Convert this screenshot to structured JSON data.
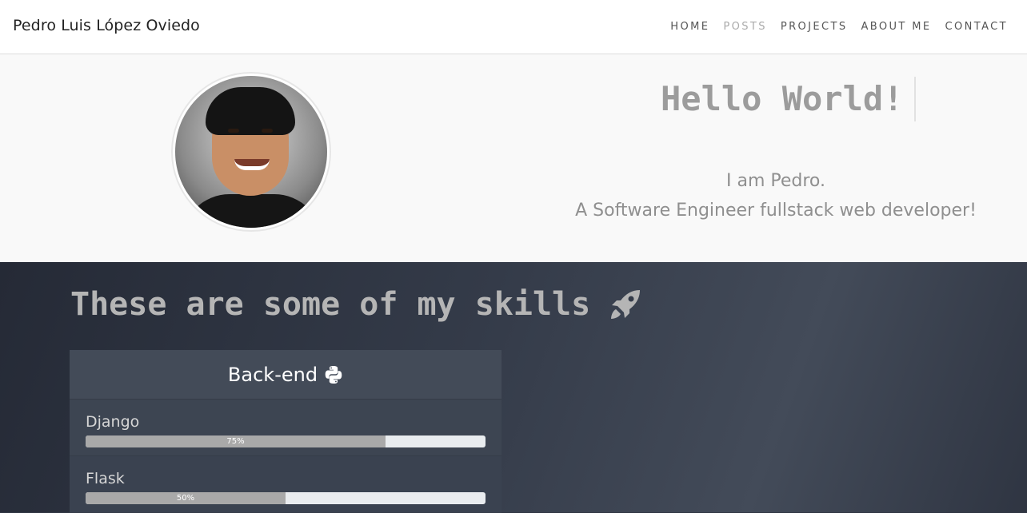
{
  "brand": "Pedro Luis López Oviedo",
  "nav": {
    "home": "HOME",
    "posts": "POSTS",
    "projects": "PROJECTS",
    "about": "ABOUT ME",
    "contact": "CONTACT"
  },
  "hero": {
    "greeting": "Hello World!",
    "line1": "I am Pedro.",
    "line2": "A Software Engineer fullstack web developer!"
  },
  "skills": {
    "title": "These are some of my skills",
    "title_icon": "rocket-icon",
    "card": {
      "title": "Back-end",
      "icon": "python-icon",
      "items": [
        {
          "name": "Django",
          "label": "75%",
          "percent": 75
        },
        {
          "name": "Flask",
          "label": "50%",
          "percent": 50
        }
      ]
    }
  },
  "colors": {
    "skills_bg": "#2f3542",
    "bar_fill": "#a9a9a9",
    "bar_track": "#e9ecef"
  }
}
